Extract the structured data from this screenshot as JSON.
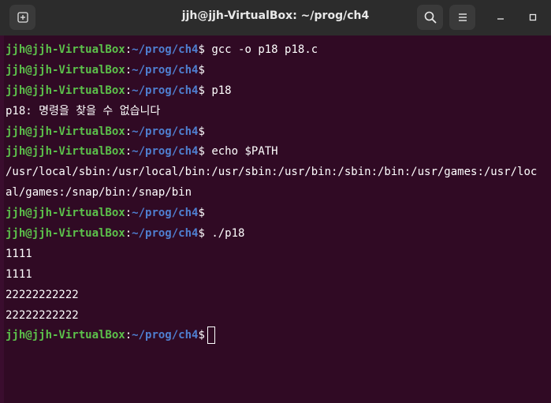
{
  "window": {
    "title": "jjh@jjh-VirtualBox: ~/prog/ch4",
    "buttons": {
      "new_tab_icon": "new-tab-icon",
      "search_icon": "search-icon",
      "menu_icon": "hamburger-menu-icon",
      "minimize_icon": "minimize-icon",
      "maximize_icon": "maximize-icon"
    }
  },
  "prompt": {
    "user_host": "jjh@jjh-VirtualBox",
    "colon": ":",
    "path": "~/prog/ch4",
    "dollar": "$"
  },
  "colors": {
    "terminal_bg": "#300a24",
    "user_host": "#5cc14b",
    "path": "#4f7fd0",
    "text": "#ffffff",
    "titlebar_bg": "#2c2c2c"
  },
  "terminal": {
    "cmd1": " gcc -o p18 p18.c",
    "cmd2": "",
    "cmd3": " p18",
    "out_notfound": "p18: 명령을 찾을 수 없습니다",
    "cmd4": "",
    "cmd5": " echo $PATH",
    "out_path_1": "/usr/local/sbin:/usr/local/bin:/usr/sbin:/usr/bin:/sbin:/bin:/usr/games:/usr/loc",
    "out_path_2": "al/games:/snap/bin:/snap/bin",
    "cmd6": "",
    "cmd7": " ./p18",
    "out_1": "1111",
    "out_2": "1111",
    "out_3": "22222222222",
    "out_4": "22222222222",
    "cmd8": " "
  }
}
